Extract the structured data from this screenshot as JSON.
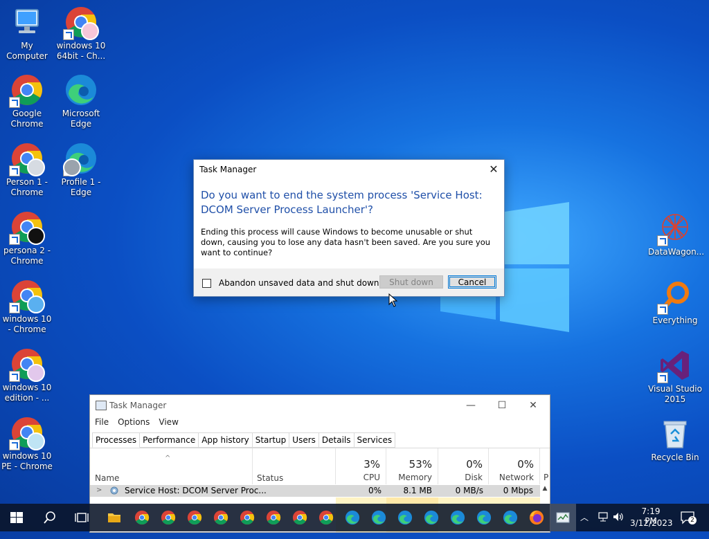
{
  "desktop": {
    "icons_left": [
      {
        "label": "My Computer"
      },
      {
        "label": "windows 10 64bit - Ch..."
      },
      {
        "label": "Google Chrome"
      },
      {
        "label": "Microsoft Edge"
      },
      {
        "label": "Person 1 - Chrome"
      },
      {
        "label": "Profile 1 - Edge"
      },
      {
        "label": "persona 2 - Chrome"
      },
      {
        "label": "windows 10 - Chrome"
      },
      {
        "label": "windows 10 edition - ..."
      },
      {
        "label": "windows 10 PE - Chrome"
      }
    ],
    "icons_right": [
      {
        "label": "DataWagon..."
      },
      {
        "label": "Everything"
      },
      {
        "label": "Visual Studio 2015"
      },
      {
        "label": "Recycle Bin"
      }
    ]
  },
  "dialog": {
    "title": "Task Manager",
    "close_glyph": "✕",
    "heading": "Do you want to end the system process 'Service Host: DCOM Server Process Launcher'?",
    "body": "Ending this process will cause Windows to become unusable or shut down, causing you to lose any data hasn't been saved. Are you sure you want to continue?",
    "checkbox_label": "Abandon unsaved data and shut down.",
    "shutdown_label": "Shut down",
    "cancel_label": "Cancel"
  },
  "taskmanager": {
    "title": "Task Manager",
    "minimize": "—",
    "maximize": "☐",
    "close": "✕",
    "menu": [
      "File",
      "Options",
      "View"
    ],
    "tabs": [
      "Processes",
      "Performance",
      "App history",
      "Startup",
      "Users",
      "Details",
      "Services"
    ],
    "columns": {
      "name": "Name",
      "status": "Status",
      "cpu_pct": "3%",
      "cpu": "CPU",
      "mem_pct": "53%",
      "mem": "Memory",
      "disk_pct": "0%",
      "disk": "Disk",
      "net_pct": "0%",
      "net": "Network",
      "power": "P"
    },
    "rows": [
      {
        "name": "Service Host: DCOM Server Proc...",
        "cpu": "0%",
        "memory": "8.1 MB",
        "disk": "0 MB/s",
        "network": "0 Mbps"
      }
    ]
  },
  "taskbar": {
    "time": "7:19 PM",
    "date": "3/12/2023",
    "notifications": "2"
  },
  "colors": {
    "accent": "#0078d7",
    "heading": "#1f4fa8"
  }
}
